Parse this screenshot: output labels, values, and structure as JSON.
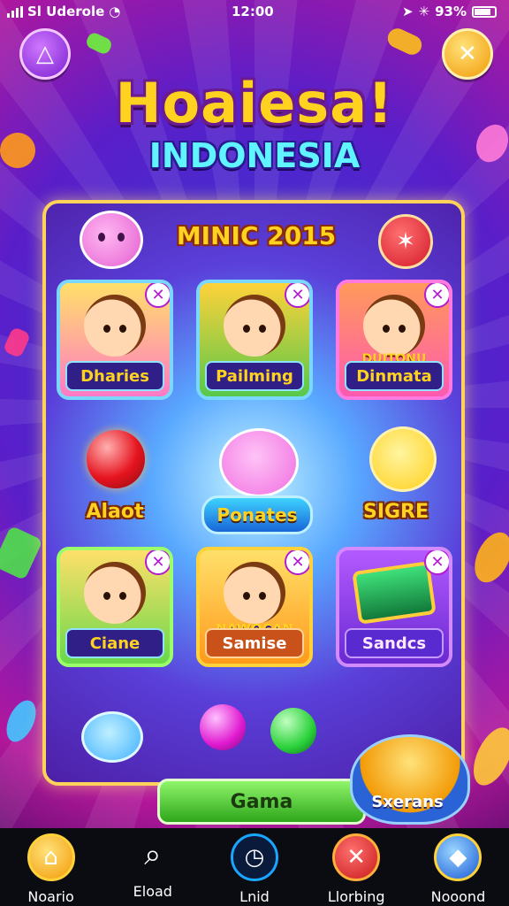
{
  "status_bar": {
    "carrier": "Sl Uderole",
    "time": "12:00",
    "battery_text": "93%",
    "icons": [
      "signal-bars-icon",
      "wifi-icon",
      "location-icon",
      "bluetooth-icon",
      "battery-icon"
    ]
  },
  "header": {
    "title": "Hoaiesa!",
    "subtitle": "INDONESIA",
    "left_button_icon": "triangle-icon",
    "close_button_icon": "close-icon"
  },
  "panel": {
    "title": "MINIC 2015",
    "badge_icon": "star-badge-icon"
  },
  "cards_row1": [
    {
      "label": "Dharies",
      "icon": "girl-character-icon"
    },
    {
      "label": "Pailming",
      "icon": "boy-character-icon"
    },
    {
      "label": "Dinmata",
      "sublabel": "DUITONU",
      "icon": "boy-character-icon"
    }
  ],
  "middle_row": [
    {
      "label": "Alaot",
      "icon": "red-orb-icon"
    },
    {
      "label": "Ponates",
      "icon": "pink-cat-icon"
    },
    {
      "label": "SIGRE",
      "icon": "yellow-bear-icon"
    }
  ],
  "cards_row2": [
    {
      "label": "Ciane",
      "icon": "boy-character-icon"
    },
    {
      "label": "Samise",
      "sublabel": "NAWOCAN",
      "icon": "boy-character-icon"
    },
    {
      "label": "Sandcs",
      "icon": "tablet-icon"
    }
  ],
  "bottom": {
    "play_label": "Gama",
    "chest_label": "Sxerans"
  },
  "nav": [
    {
      "label": "Noario",
      "icon": "home-icon",
      "color": "#f5b500"
    },
    {
      "label": "Eload",
      "icon": "search-icon",
      "color": "#1a1a22"
    },
    {
      "label": "Lnid",
      "icon": "clock-icon",
      "color": "#0c8fd6"
    },
    {
      "label": "Llorbing",
      "icon": "x-badge-icon",
      "color": "#d62020"
    },
    {
      "label": "Nooond",
      "icon": "gem-icon",
      "color": "#3a8fff"
    }
  ]
}
